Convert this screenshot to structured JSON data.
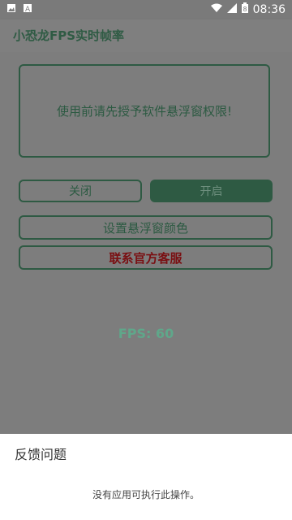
{
  "status_bar": {
    "time": "08:36",
    "battery_level": "8",
    "icons": [
      "image-icon",
      "a-icon",
      "wifi-icon",
      "signal-icon",
      "battery-icon"
    ]
  },
  "app": {
    "title": "小恐龙FPS实时帧率"
  },
  "main": {
    "notice": "使用前请先授予软件悬浮窗权限!",
    "close_button": "关闭",
    "open_button": "开启",
    "set_color_button": "设置悬浮窗颜色",
    "contact_button": "联系官方客服",
    "fps": "FPS: 60"
  },
  "sheet": {
    "title": "反馈问题",
    "message": "没有应用可执行此操作。"
  },
  "colors": {
    "accent": "#2e5a43",
    "fps_text": "#5fa78a",
    "contact_text": "#7a0f12"
  }
}
